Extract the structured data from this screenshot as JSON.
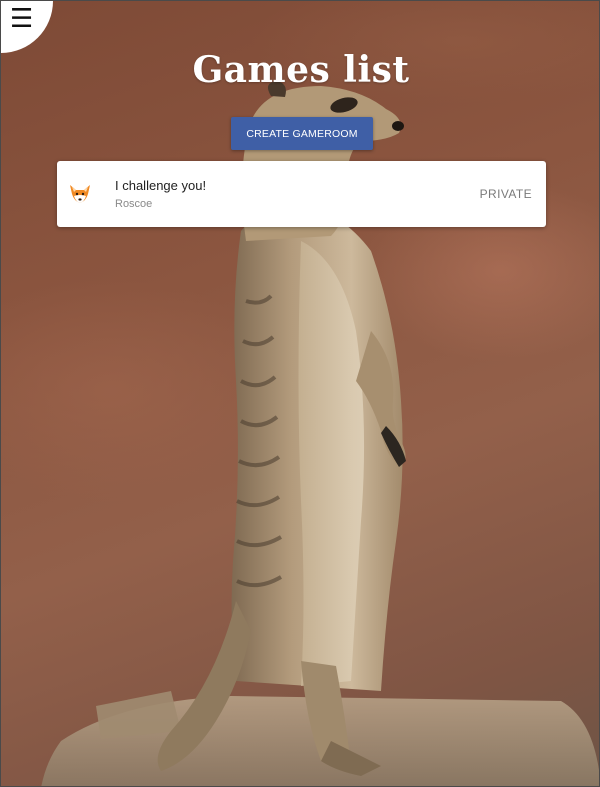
{
  "menu": {
    "icon": "hamburger-menu-icon",
    "glyph": "☰"
  },
  "header": {
    "title": "Games list"
  },
  "actions": {
    "create_label": "CREATE GAMEROOM",
    "button_color": "#3f5fa6"
  },
  "games": [
    {
      "title": "I challenge you!",
      "owner": "Roscoe",
      "privacy": "PRIVATE",
      "avatar_icon": "fox-face-icon"
    }
  ],
  "background": {
    "subject": "meerkat-photo"
  }
}
